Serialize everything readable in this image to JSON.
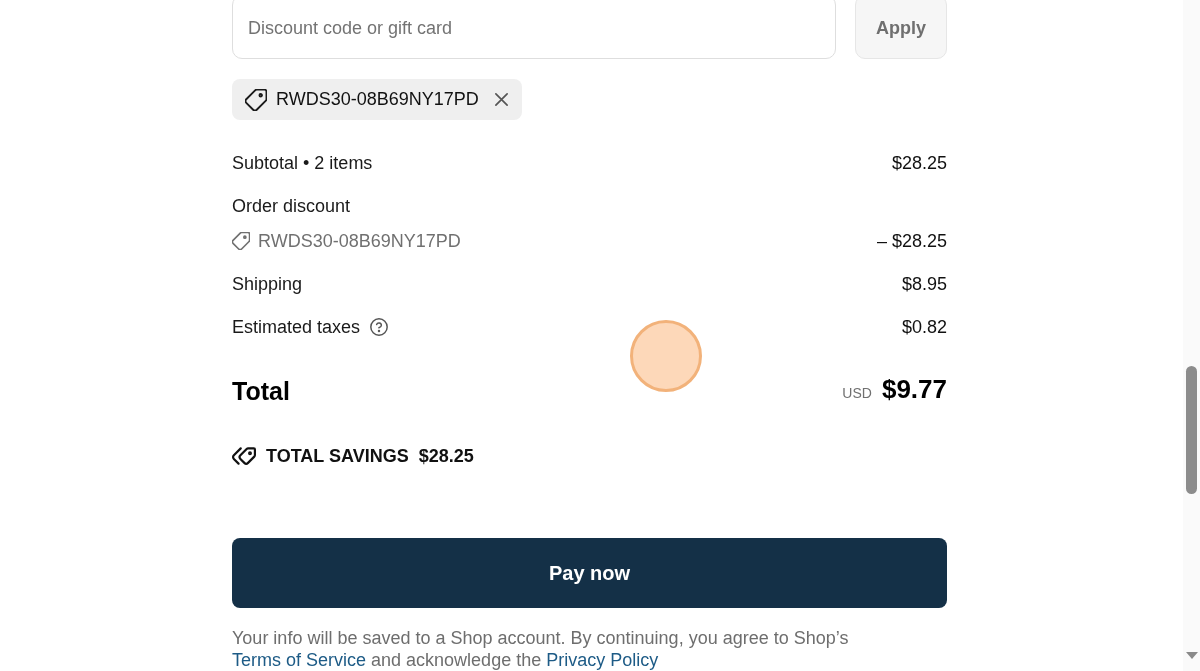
{
  "discount": {
    "placeholder": "Discount code or gift card",
    "apply_button": "Apply"
  },
  "applied_codes": [
    {
      "code": "RWDS30-08B69NY17PD"
    }
  ],
  "summary": {
    "rows": [
      {
        "kind": "plain",
        "label": "Subtotal • 2 items",
        "value": "$28.25"
      },
      {
        "kind": "discount",
        "label": "Order discount",
        "code": "RWDS30-08B69NY17PD",
        "value": "– $28.25"
      },
      {
        "kind": "plain",
        "label": "Shipping",
        "value": "$8.95"
      },
      {
        "kind": "info",
        "label": "Estimated taxes",
        "value": "$0.82"
      }
    ],
    "total": {
      "label": "Total",
      "currency": "USD",
      "value": "$9.77"
    },
    "savings": {
      "label": "TOTAL SAVINGS",
      "value": "$28.25"
    }
  },
  "pay_button": "Pay now",
  "legal": [
    {
      "kind": "text",
      "text": "Your info will be saved to a Shop account. By continuing, you agree to Shop’s "
    },
    {
      "kind": "link",
      "text": "Terms of Service"
    },
    {
      "kind": "text",
      "text": " and acknowledge the "
    },
    {
      "kind": "link",
      "text": "Privacy Policy"
    }
  ]
}
